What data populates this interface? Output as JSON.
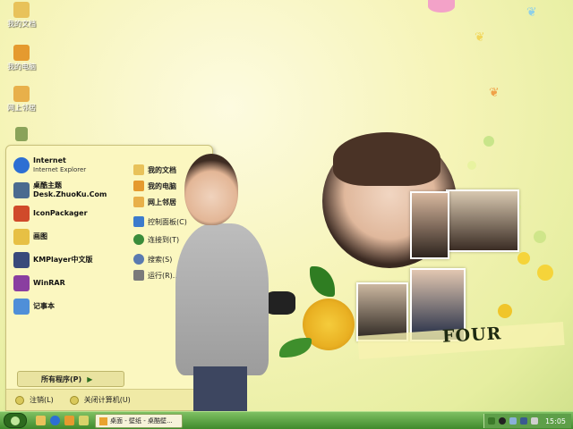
{
  "desktop": {
    "icons": [
      {
        "label": "我的文档",
        "color": "#e8c25a"
      },
      {
        "label": "我的电脑",
        "color": "#e59a2f"
      },
      {
        "label": "网上邻居",
        "color": "#e8b04a"
      },
      {
        "label": "",
        "color": "#8aa35a"
      }
    ]
  },
  "start_menu": {
    "pinned": [
      {
        "title": "Internet",
        "subtitle": "Internet Explorer",
        "icon": "ie-icon",
        "color": "#2d6fd3"
      },
      {
        "title": "桌酷主题Desk.ZhuoKu.Com",
        "icon": "zhuoku-icon",
        "color": "#4b6b8f"
      },
      {
        "title": "IconPackager",
        "icon": "iconpackager-icon",
        "color": "#d04a2a"
      },
      {
        "title": "画图",
        "icon": "paint-icon",
        "color": "#e7c044"
      },
      {
        "title": "KMPlayer中文版",
        "icon": "kmplayer-icon",
        "color": "#3a4a7a"
      },
      {
        "title": "WinRAR",
        "icon": "winrar-icon",
        "color": "#8a3fa0"
      },
      {
        "title": "记事本",
        "icon": "notepad-icon",
        "color": "#4f8fd8"
      }
    ],
    "all_programs": "所有程序(P)",
    "all_programs_arrow": "▶",
    "places": [
      {
        "label": "我的文档",
        "bold": true,
        "icon": "documents-icon",
        "color": "#e8c25a"
      },
      {
        "label": "我的电脑",
        "bold": true,
        "icon": "computer-icon",
        "color": "#e59a2f"
      },
      {
        "label": "网上邻居",
        "bold": true,
        "icon": "network-icon",
        "color": "#e8b04a"
      },
      {
        "label": "控制面板(C)",
        "bold": false,
        "icon": "control-panel-icon",
        "color": "#3c7bcc"
      },
      {
        "label": "连接到(T)",
        "bold": false,
        "icon": "connect-icon",
        "color": "#3a8c3a"
      },
      {
        "label": "搜索(S)",
        "bold": false,
        "icon": "search-icon",
        "color": "#5a7ab0"
      },
      {
        "label": "运行(R)...",
        "bold": false,
        "icon": "run-icon",
        "color": "#7a7a7a"
      }
    ],
    "logoff": "注销(L)",
    "shutdown": "关闭计算机(U)"
  },
  "wallpaper": {
    "logo_text": "FOUR"
  },
  "taskbar": {
    "task_label": "桌面 - 壁纸 - 桌酷壁...",
    "clock": "15:05"
  },
  "colors": {
    "taskbar_green": "#4f9a3a",
    "menu_bg": "#fbf7c0"
  }
}
